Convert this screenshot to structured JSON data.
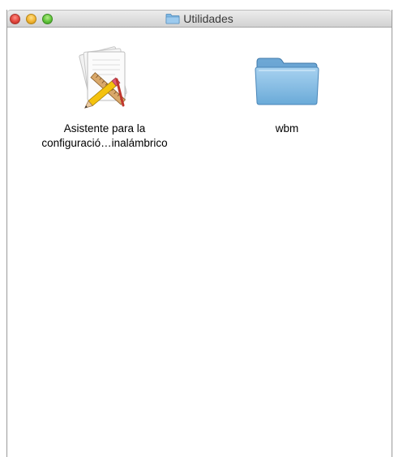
{
  "window": {
    "title": "Utilidades"
  },
  "items": [
    {
      "name_line1": "Asistente para la",
      "name_line2": "configuració…inalámbrico",
      "icon": "app-installer-icon"
    },
    {
      "name": "wbm",
      "icon": "folder-icon"
    }
  ],
  "colors": {
    "folder": "#6eaedc",
    "titlebar_top": "#ececec",
    "titlebar_bottom": "#d2d2d2"
  }
}
